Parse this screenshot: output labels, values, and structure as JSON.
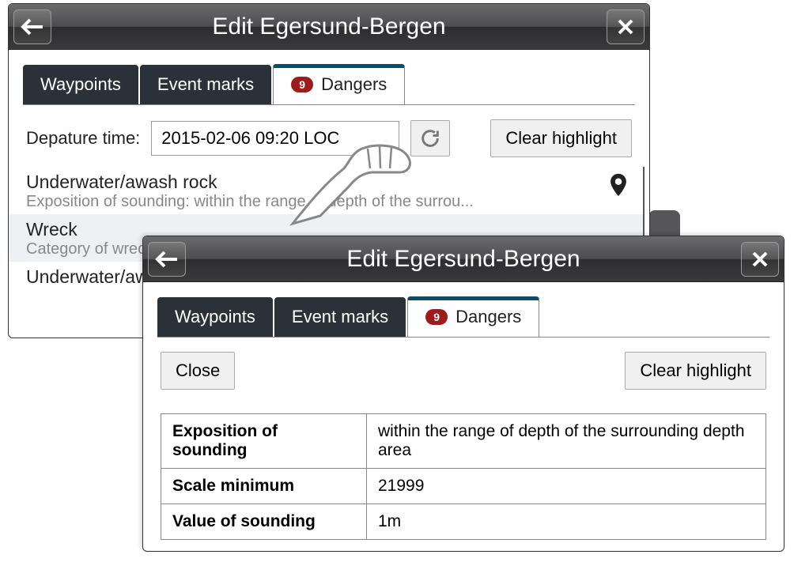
{
  "windowBack": {
    "title": "Edit Egersund-Bergen",
    "tabs": {
      "waypoints": "Waypoints",
      "eventMarks": "Event marks",
      "dangers": "Dangers",
      "dangersBadge": "9"
    },
    "departureLabel": "Depature time:",
    "departureValue": "2015-02-06 09:20 LOC",
    "clearHighlight": "Clear highlight",
    "items": [
      {
        "title": "Underwater/awash rock",
        "sub": "Exposition of sounding: within the range of depth of the surrou..."
      },
      {
        "title": "Wreck",
        "sub": "Category of wreck"
      },
      {
        "title": "Underwater/aw",
        "sub": ""
      }
    ]
  },
  "windowFront": {
    "title": "Edit Egersund-Bergen",
    "tabs": {
      "waypoints": "Waypoints",
      "eventMarks": "Event marks",
      "dangers": "Dangers",
      "dangersBadge": "9"
    },
    "close": "Close",
    "clearHighlight": "Clear highlight",
    "rows": [
      {
        "key": "Exposition of sounding",
        "val": "within the range of depth of the surrounding depth area"
      },
      {
        "key": "Scale minimum",
        "val": "21999"
      },
      {
        "key": "Value of sounding",
        "val": "1m"
      }
    ]
  }
}
